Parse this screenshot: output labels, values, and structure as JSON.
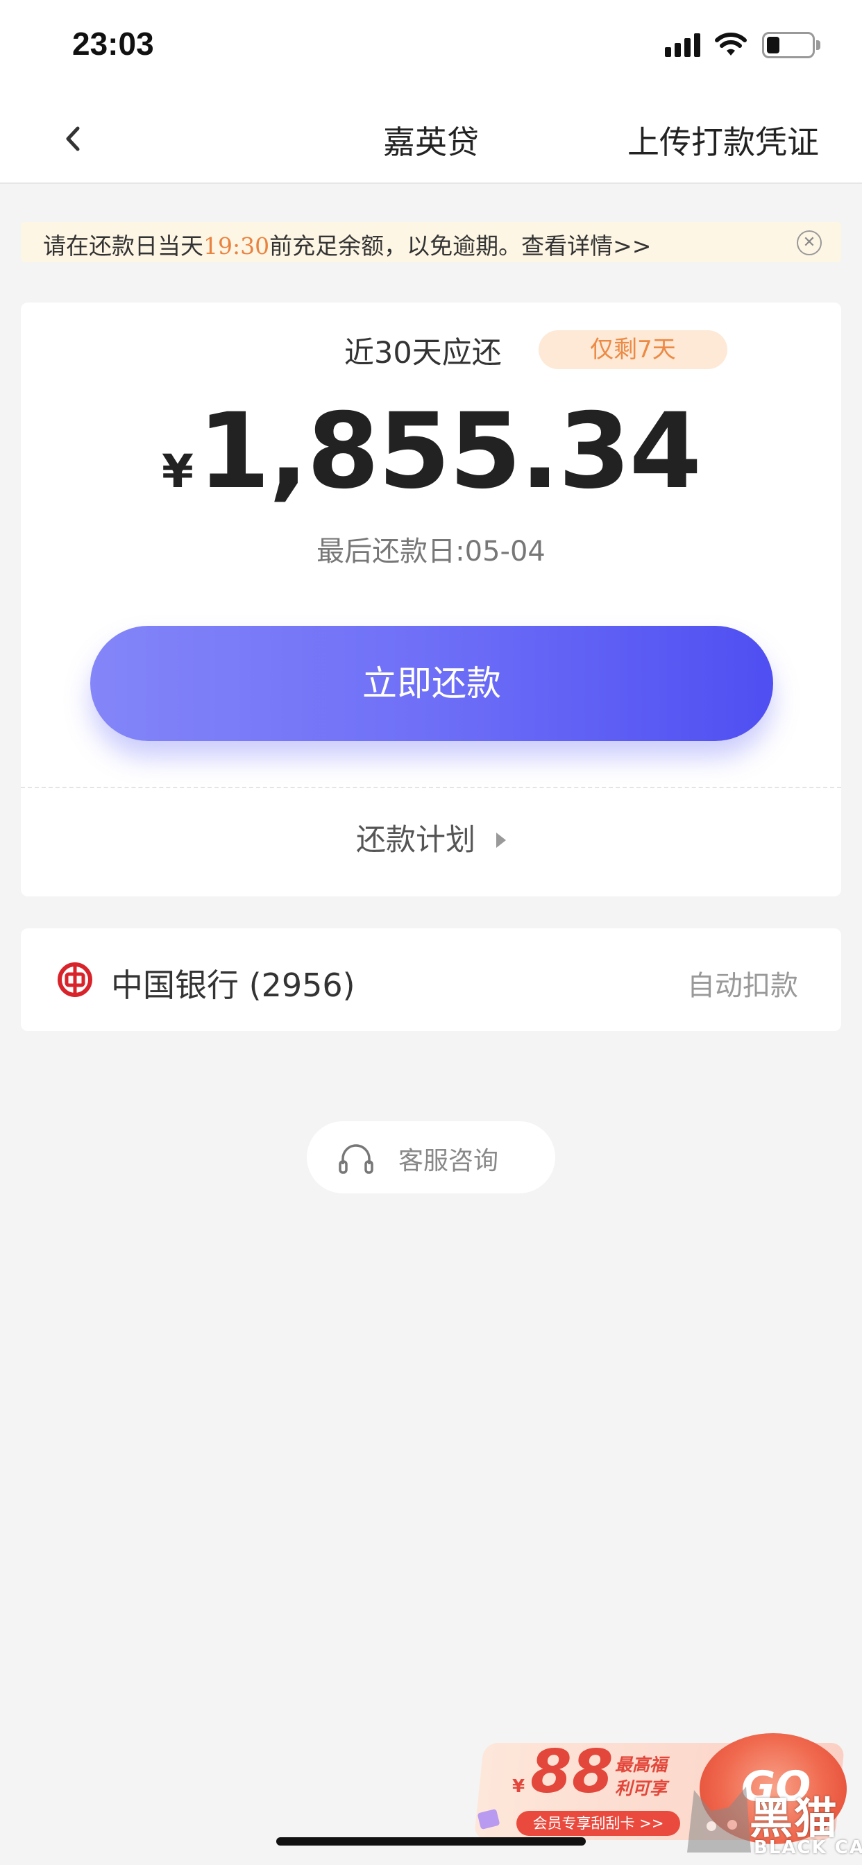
{
  "status_bar": {
    "time": "23:03"
  },
  "nav": {
    "title": "嘉英贷",
    "action": "上传打款凭证"
  },
  "notice": {
    "prefix": "请在还款日当天",
    "highlight": "19:30",
    "suffix": "前充足余额，以免逾期。查看详情>>"
  },
  "repayment": {
    "period_label": "近30天应还",
    "days_left_badge": "仅剩7天",
    "currency": "¥",
    "amount": "1,855.34",
    "due_date": "最后还款日:05-04",
    "pay_button": "立即还款",
    "plan_link": "还款计划"
  },
  "bank": {
    "name": "中国银行 (2956)",
    "tag": "自动扣款"
  },
  "service": {
    "label": "客服咨询"
  },
  "promo": {
    "currency": "¥",
    "amount": "88",
    "line1": "最高福",
    "line2": "利可享",
    "pill": "会员专享刮刮卡 >>",
    "go": "GO"
  },
  "watermark": {
    "text": "黑猫",
    "sub": "BLACK CAT"
  },
  "colors": {
    "accent": "#5b5cf4",
    "highlight": "#e9823f",
    "badge_bg": "#fde9d6",
    "bank_red": "#d8232a"
  }
}
